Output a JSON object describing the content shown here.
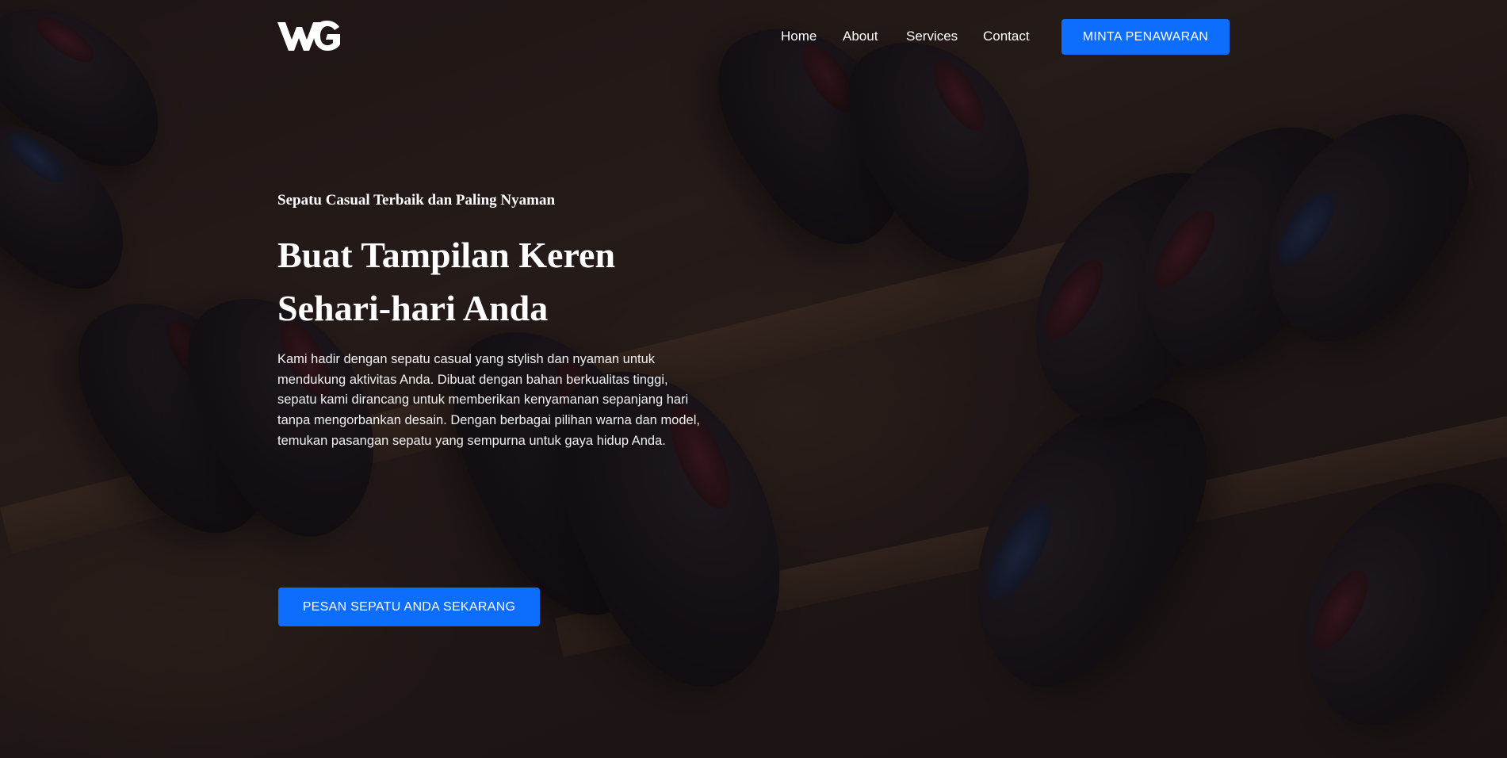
{
  "brand": {
    "logo_text": "WG"
  },
  "nav": {
    "items": [
      {
        "label": "Home"
      },
      {
        "label": "About"
      },
      {
        "label": "Services"
      },
      {
        "label": "Contact"
      }
    ],
    "cta_label": "MINTA PENAWARAN"
  },
  "hero": {
    "subtitle": "Sepatu Casual Terbaik dan Paling Nyaman",
    "headline_line1": "Buat Tampilan Keren",
    "headline_line2": "Sehari-hari Anda",
    "description": "Kami hadir dengan sepatu casual yang stylish dan nyaman untuk mendukung aktivitas Anda. Dibuat dengan bahan berkualitas tinggi, sepatu kami dirancang untuk memberikan kenyamanan sepanjang hari tanpa mengorbankan desain. Dengan berbagai pilihan warna dan model, temukan pasangan sepatu yang sempurna untuk gaya hidup Anda.",
    "cta_label": "PESAN SEPATU ANDA SEKARANG"
  },
  "colors": {
    "accent": "#0d6efd",
    "overlay": "#140e10",
    "text": "#ffffff"
  }
}
